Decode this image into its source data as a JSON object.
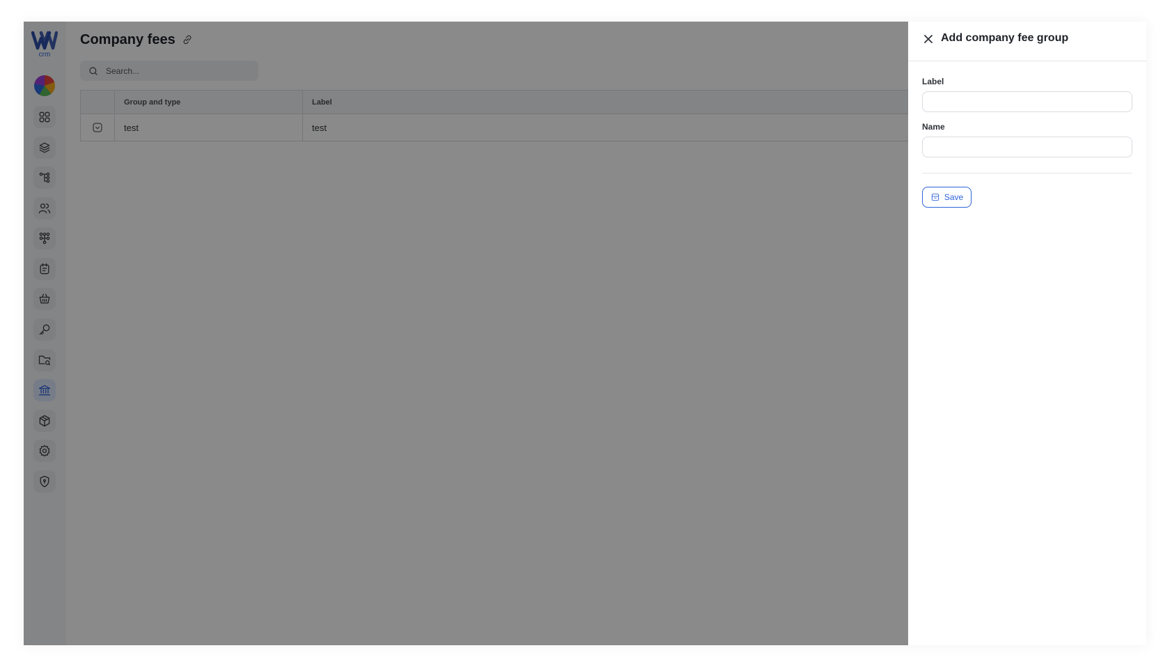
{
  "app": {
    "logo_text": "crm",
    "page_title": "Company fees",
    "search": {
      "placeholder": "Search..."
    },
    "table": {
      "columns": [
        "Group and type",
        "Label"
      ],
      "rows": [
        {
          "group_and_type": "test",
          "label": "test"
        }
      ]
    },
    "sidebar": {
      "items": [
        {
          "icon": "grid-icon"
        },
        {
          "icon": "layers-icon"
        },
        {
          "icon": "hierarchy-icon"
        },
        {
          "icon": "users-icon"
        },
        {
          "icon": "network-icon"
        },
        {
          "icon": "calendar-notes-icon"
        },
        {
          "icon": "basket-icon"
        },
        {
          "icon": "key-icon"
        },
        {
          "icon": "folder-search-icon"
        },
        {
          "icon": "bank-icon",
          "active": true
        },
        {
          "icon": "box-icon"
        },
        {
          "icon": "settings-gear-icon"
        },
        {
          "icon": "shield-icon"
        }
      ]
    }
  },
  "drawer": {
    "title": "Add company fee group",
    "fields": [
      {
        "label": "Label",
        "value": ""
      },
      {
        "label": "Name",
        "value": ""
      }
    ],
    "save_label": "Save"
  },
  "colors": {
    "accent": "#2f63d8",
    "overlay": "rgba(0,0,0,0.46)",
    "sidebar_bg": "#f4f5f7"
  }
}
